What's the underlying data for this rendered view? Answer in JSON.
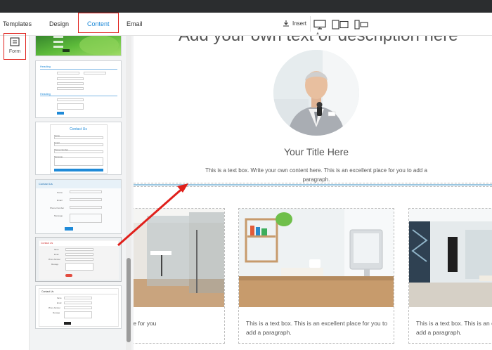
{
  "nav": {
    "tabs": [
      "Templates",
      "Design",
      "Content",
      "Email"
    ],
    "active_tab": "Content",
    "insert_label": "Insert",
    "devices": [
      "desktop-icon",
      "tablet-icon",
      "mobile-icon"
    ]
  },
  "tools": {
    "form_label": "Form"
  },
  "panel": {
    "thumb2": {
      "section1": "Heading",
      "section2": "Heading"
    },
    "thumb3": {
      "title": "Contact Us",
      "fields": [
        "Name",
        "Email",
        "Phone Number",
        "Message"
      ]
    },
    "thumb4": {
      "title": "Contact Us",
      "fields": [
        "Name",
        "Email",
        "Phone Number",
        "Message"
      ]
    },
    "thumb5": {
      "title": "Contact Us",
      "fields": [
        "Name",
        "Email",
        "Phone Number",
        "Message"
      ]
    },
    "thumb6": {
      "title": "Contact Us",
      "fields": [
        "Name",
        "Email",
        "Phone Number",
        "Message"
      ]
    }
  },
  "canvas": {
    "heading": "Add your own text or description here",
    "title": "Your Title Here",
    "textbox": "This is a text box. Write your own content here. This is an excellent place for you to add a paragraph.",
    "cards": [
      {
        "text": "is is an excellent place for you"
      },
      {
        "text": "This is a text box. This is an excellent place for you to add a paragraph."
      },
      {
        "text": "This is a text box. This is an excellent place for you to add a paragraph."
      }
    ]
  },
  "colors": {
    "accent": "#1f8ad8",
    "highlight": "#e0201b",
    "topbar": "#2b2d2f"
  }
}
